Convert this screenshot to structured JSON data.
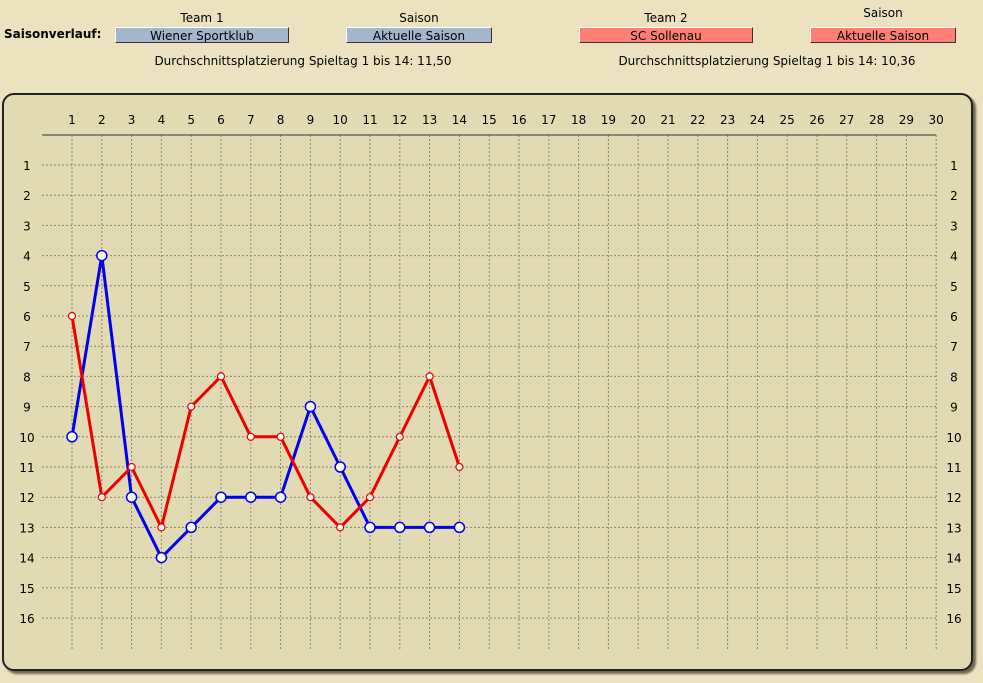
{
  "header": {
    "title": "Saisonverlauf:",
    "team1": {
      "heading": "Team 1",
      "value": "Wiener Sportklub",
      "color": "#a4b6cc"
    },
    "season1": {
      "heading": "Saison",
      "value": "Aktuelle Saison",
      "color": "#a4b6cc"
    },
    "team2": {
      "heading": "Team 2",
      "value": "SC Sollenau",
      "color": "#ff7f74"
    },
    "season2": {
      "heading": "Saison",
      "value": "Aktuelle Saison",
      "color": "#ff7f74"
    },
    "avg1": "Durchschnittsplatzierung Spieltag 1 bis 14: 11,50",
    "avg2": "Durchschnittsplatzierung Spieltag 1 bis 14: 10,36"
  },
  "chart_data": {
    "type": "line",
    "x": [
      1,
      2,
      3,
      4,
      5,
      6,
      7,
      8,
      9,
      10,
      11,
      12,
      13,
      14,
      15,
      16,
      17,
      18,
      19,
      20,
      21,
      22,
      23,
      24,
      25,
      26,
      27,
      28,
      29,
      30
    ],
    "y_ticks": [
      1,
      2,
      3,
      4,
      5,
      6,
      7,
      8,
      9,
      10,
      11,
      12,
      13,
      14,
      15,
      16
    ],
    "xlim": [
      1,
      30
    ],
    "ylim": [
      16,
      1
    ],
    "y_inverted": true,
    "grid": true,
    "series": [
      {
        "name": "Wiener Sportklub",
        "color": "#0000ee",
        "values": [
          10,
          4,
          12,
          14,
          13,
          12,
          12,
          12,
          9,
          11,
          13,
          13,
          13,
          13
        ]
      },
      {
        "name": "SC Sollenau",
        "color": "#ee0000",
        "values": [
          6,
          12,
          11,
          13,
          9,
          8,
          10,
          10,
          12,
          13,
          12,
          10,
          8,
          11
        ]
      }
    ]
  }
}
